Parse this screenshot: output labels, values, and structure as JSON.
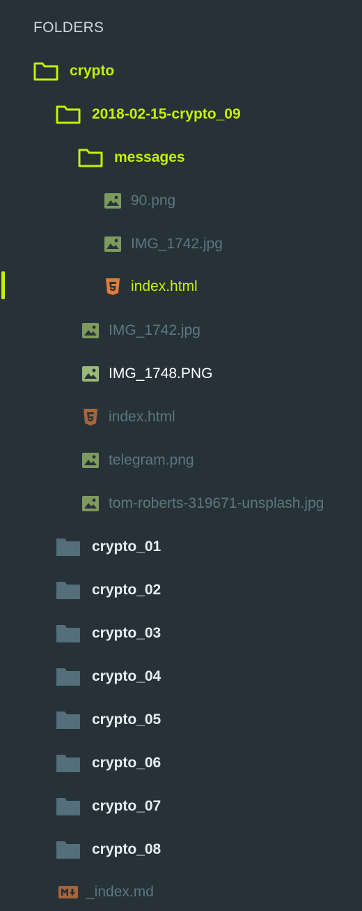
{
  "sidebar": {
    "header": "FOLDERS",
    "tree": {
      "crypto": "crypto",
      "crypto_09": "2018-02-15-crypto_09",
      "messages": "messages",
      "messages_files": [
        "90.png",
        "IMG_1742.jpg",
        "index.html"
      ],
      "crypto_09_files": [
        "IMG_1742.jpg",
        "IMG_1748.PNG",
        "index.html",
        "telegram.png",
        "tom-roberts-319671-unsplash.jpg"
      ],
      "closed_folders": [
        "crypto_01",
        "crypto_02",
        "crypto_03",
        "crypto_04",
        "crypto_05",
        "crypto_06",
        "crypto_07",
        "crypto_08"
      ],
      "root_file": "_index.md"
    }
  },
  "icons": {
    "folder_open": "folder-open-icon",
    "folder_closed": "folder-closed-icon",
    "image": "image-file-icon",
    "html": "html5-icon",
    "markdown": "markdown-icon"
  },
  "colors": {
    "background": "#263238",
    "accent": "#c6f000",
    "folder_closed": "#546e7a",
    "image_icon": "#7f9a5e",
    "html_icon": "#e07b39",
    "dim_text": "#5e7781"
  }
}
